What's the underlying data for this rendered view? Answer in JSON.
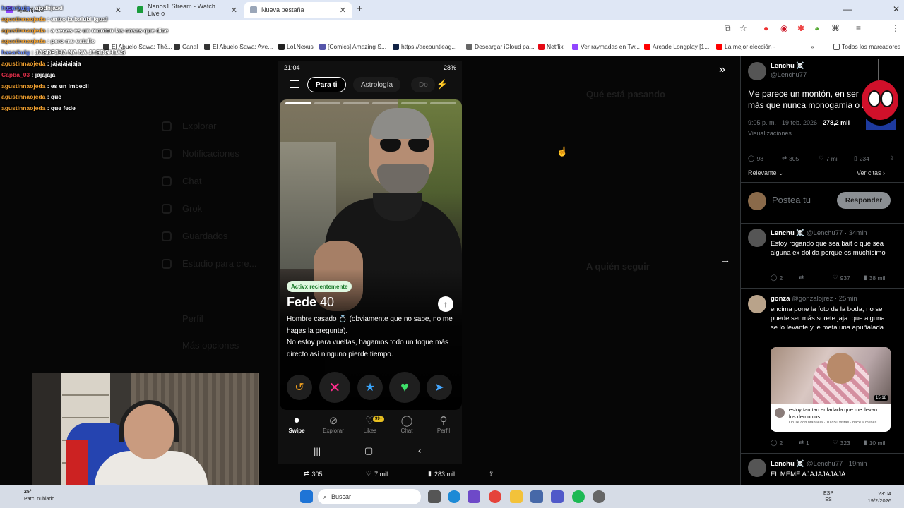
{
  "browser": {
    "tabs": [
      {
        "label": "ajsdhjasd"
      },
      {
        "label": "Nanos1 Stream - Watch Live o"
      },
      {
        "label": "Nueva pestaña"
      }
    ],
    "bookmarks": [
      "El Abuelo Sawa: Thé...",
      "Canal",
      "El Abuelo Sawa: Ave...",
      "Lol.Nexus",
      "[Comics] Amazing S...",
      "https://accountleag...",
      "Descargar iCloud pa...",
      "Netflix",
      "Ver raymadas en Tw...",
      "Arcade Longplay [1...",
      "La mejor elección -",
      "Todos los marcadores"
    ]
  },
  "chat": [
    {
      "user": "hasarkulg",
      "msg": "ajsdhjasd",
      "color": "blue"
    },
    {
      "user": "agustinnaojeda",
      "msg": "entro la balubi igual",
      "color": "orange"
    },
    {
      "user": "agustinnaojeda",
      "msg": "a veces es un monton las cosas que dice",
      "color": "orange"
    },
    {
      "user": "agustinnaojeda",
      "msg": "pero me estallo",
      "color": "orange"
    },
    {
      "user": "hasarkulg",
      "msg": "JASDFJHA NA NA JASDGHJAS",
      "color": "blue"
    },
    {
      "user": "agustinnaojeda",
      "msg": "jajajajajaja",
      "color": "orange"
    },
    {
      "user": "Capba_03",
      "msg": "jajajaja",
      "color": "red"
    },
    {
      "user": "agustinnaojeda",
      "msg": "es un imbecil",
      "color": "orange"
    },
    {
      "user": "agustinnaojeda",
      "msg": "que",
      "color": "orange"
    },
    {
      "user": "agustinnaojeda",
      "msg": "que fede",
      "color": "orange"
    }
  ],
  "background_nav": [
    "Explorar",
    "Notificaciones",
    "Chat",
    "Grok",
    "Guardados",
    "Estudio para cre...",
    "Perfil",
    "Más opciones"
  ],
  "background_trends": {
    "title": "Qué está pasando",
    "follow_title": "A quién seguir"
  },
  "phone": {
    "time": "21:04",
    "battery": "28%",
    "tabs": [
      "Para ti",
      "Astrología",
      "Do"
    ],
    "active_badge": "Activx recientemente",
    "name": "Fede",
    "age": "40",
    "bio_lines": [
      "Hombre casado 💍 (obviamente que no sabe, no me hagas la pregunta).",
      "No estoy para vueltas, hagamos todo un toque más directo así ninguno pierde tiempo."
    ],
    "nav": [
      {
        "label": "Swipe",
        "icon": "flame-icon"
      },
      {
        "label": "Explorar",
        "icon": "compass-icon"
      },
      {
        "label": "Likes",
        "icon": "heart-icon",
        "badge": "99+"
      },
      {
        "label": "Chat",
        "icon": "chat-icon"
      },
      {
        "label": "Perfil",
        "icon": "person-icon"
      }
    ]
  },
  "tweet_stats": {
    "retweets": "305",
    "likes": "7 mil",
    "views": "283 mil"
  },
  "main_tweet": {
    "name": "Lenchu ☠️",
    "handle": "@Lenchu77",
    "text_lines": [
      "Me parece un montón, en ser",
      "más que nunca monogamia o l"
    ],
    "time": "9:05 p. m. · 19 feb. 2026",
    "views": "278,2 mil",
    "views_label": "Visualizaciones",
    "replies": "98",
    "retweets": "305",
    "likes": "7 mil",
    "bookmarks": "234",
    "sort": "Relevante",
    "quotes": "Ver citas",
    "compose_placeholder": "Postea tu",
    "reply_button": "Responder"
  },
  "replies": [
    {
      "name": "Lenchu ☠️",
      "handle": "@Lenchu77 · 34min",
      "text": "Estoy rogando que sea bait o que sea alguna ex dolida porque es muchísimo",
      "replies": "2",
      "retweets": "",
      "likes": "937",
      "views": "38 mil"
    },
    {
      "name": "gonza",
      "handle": "@gonzalojrez · 25min",
      "text": "encima pone la foto de la boda, no se puede ser más sorete jaja. que alguna se lo levante y le meta una apuñalada",
      "embed_title": "estoy tan tan enfadada que me llevan los demonios",
      "embed_sub": "Un Té con Manuela · 10.850 vistas · hace 9 meses",
      "embed_duration": "15:18",
      "replies": "2",
      "retweets": "1",
      "likes": "323",
      "views": "10 mil"
    },
    {
      "name": "Lenchu ☠️",
      "handle": "@Lenchu77 · 19min",
      "text": "EL MEME AJAJAJAJAJA"
    }
  ],
  "taskbar": {
    "weather_temp": "25°",
    "weather_desc": "Parc. nublado",
    "search_placeholder": "Buscar",
    "lang": "ESP",
    "lang2": "ES",
    "time": "23:04",
    "date": "19/2/2026"
  }
}
